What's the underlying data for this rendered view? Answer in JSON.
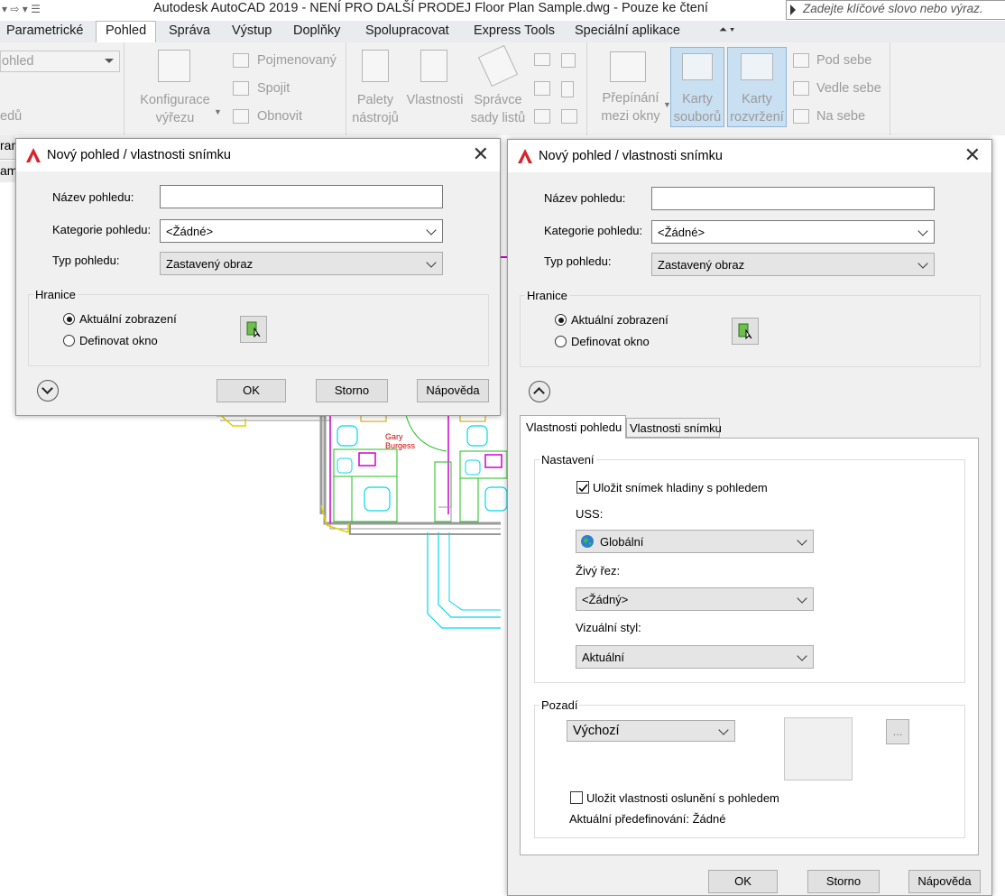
{
  "window": {
    "title": "Autodesk AutoCAD 2019 - NENÍ PRO DALŠÍ PRODEJ    Floor Plan Sample.dwg - Pouze ke čtení",
    "search_placeholder": "Zadejte klíčové slovo nebo výraz."
  },
  "ribbon": {
    "tabs": [
      "Parametrické",
      "Pohled",
      "Správa",
      "Výstup",
      "Doplňky",
      "Spolupracovat",
      "Express Tools",
      "Speciální aplikace"
    ],
    "active_tab": "Pohled",
    "left_combo": "ohled",
    "left_label": "edů",
    "viewport_config": [
      "Konfigurace",
      "výřezu"
    ],
    "viewport_actions": [
      "Pojmenovaný",
      "Spojit",
      "Obnovit"
    ],
    "palettes": [
      [
        "Palety",
        "nástrojů"
      ],
      [
        "Vlastnosti",
        ""
      ],
      [
        "Správce",
        "sady listů"
      ]
    ],
    "window_switch": [
      "Přepínání",
      "mezi okny"
    ],
    "file_tabs": [
      "Karty",
      "souborů"
    ],
    "layout_tabs": [
      "Karty",
      "rozvržení"
    ],
    "arrange": [
      "Pod sebe",
      "Vedle sebe",
      "Na sebe"
    ]
  },
  "side_fragments": [
    "ran",
    "am"
  ],
  "drawing": {
    "person_name": [
      "Gary",
      "Burgess"
    ]
  },
  "dialog1": {
    "title": "Nový pohled / vlastnosti snímku",
    "name_label": "Název pohledu:",
    "name_value": "",
    "category_label": "Kategorie pohledu:",
    "category_value": "<Žádné>",
    "type_label": "Typ pohledu:",
    "type_value": "Zastavený obraz",
    "boundary_label": "Hranice",
    "radio_current": "Aktuální zobrazení",
    "radio_define": "Definovat okno",
    "ok": "OK",
    "cancel": "Storno",
    "help": "Nápověda"
  },
  "dialog2": {
    "title": "Nový pohled / vlastnosti snímku",
    "name_label": "Název pohledu:",
    "name_value": "",
    "category_label": "Kategorie pohledu:",
    "category_value": "<Žádné>",
    "type_label": "Typ pohledu:",
    "type_value": "Zastavený obraz",
    "boundary_label": "Hranice",
    "radio_current": "Aktuální zobrazení",
    "radio_define": "Definovat okno",
    "tabs": [
      "Vlastnosti pohledu",
      "Vlastnosti snímku"
    ],
    "settings_label": "Nastavení",
    "save_layer_snapshot": "Uložit snímek hladiny s pohledem",
    "save_layer_snapshot_checked": true,
    "ucs_label": "USS:",
    "ucs_value": "Globální",
    "live_section_label": "Živý řez:",
    "live_section_value": "<Žádný>",
    "visual_style_label": "Vizuální styl:",
    "visual_style_value": "Aktuální",
    "background_label": "Pozadí",
    "background_value": "Výchozí",
    "browse_label": "...",
    "save_sun_props": "Uložit vlastnosti oslunění s pohledem",
    "save_sun_props_checked": false,
    "current_override": "Aktuální předefinování: Žádné",
    "ok": "OK",
    "cancel": "Storno",
    "help": "Nápověda"
  }
}
